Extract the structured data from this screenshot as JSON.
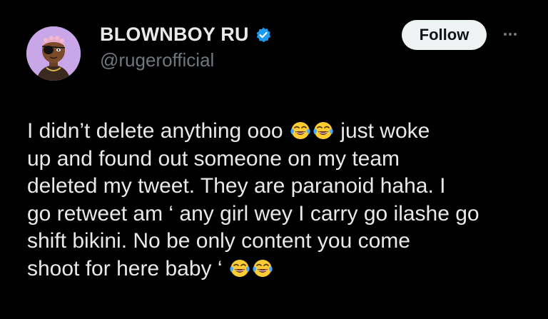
{
  "author": {
    "display_name": "BLOWNBOY RU",
    "handle": "@rugerofficial",
    "verified": true,
    "verified_color": "#1d9bf0",
    "avatar_bg": "#c9a6e8"
  },
  "actions": {
    "follow_label": "Follow",
    "more_icon": "more-horizontal-icon"
  },
  "tweet": {
    "lines": [
      {
        "before": "I didn’t delete anything ooo ",
        "emoji_count": 2,
        "after": " just woke"
      },
      {
        "text": "up and found out someone on my team"
      },
      {
        "text": "deleted my tweet. They are paranoid haha. I"
      },
      {
        "text": "go retweet am ‘ any girl wey I carry go ilashe go"
      },
      {
        "text": "shift bikini. No be only content you come"
      },
      {
        "before": "shoot for here baby ‘ ",
        "emoji_count": 2,
        "after": ""
      }
    ],
    "emoji_name": "face-with-tears-of-joy"
  },
  "colors": {
    "background": "#000000",
    "text_primary": "#e7e9ea",
    "text_secondary": "#71767b",
    "follow_bg": "#eff3f4",
    "follow_text": "#0f1419"
  }
}
